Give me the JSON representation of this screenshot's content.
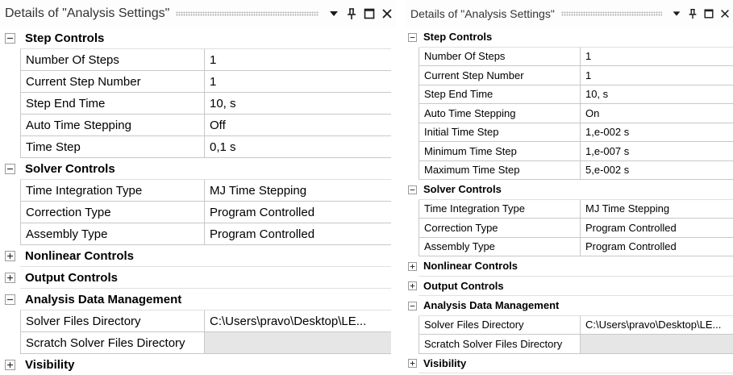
{
  "panels": [
    {
      "title": "Details of \"Analysis Settings\"",
      "sections": [
        {
          "label": "Step Controls",
          "expanded": true,
          "rows": [
            {
              "name": "Number Of Steps",
              "value": "1"
            },
            {
              "name": "Current Step Number",
              "value": "1"
            },
            {
              "name": "Step End Time",
              "value": "10, s"
            },
            {
              "name": "Auto Time Stepping",
              "value": "Off"
            },
            {
              "name": "Time Step",
              "value": "0,1 s"
            }
          ]
        },
        {
          "label": "Solver Controls",
          "expanded": true,
          "rows": [
            {
              "name": "Time Integration Type",
              "value": "MJ Time Stepping"
            },
            {
              "name": "Correction Type",
              "value": "Program Controlled"
            },
            {
              "name": "Assembly Type",
              "value": "Program Controlled"
            }
          ]
        },
        {
          "label": "Nonlinear Controls",
          "expanded": false,
          "rows": []
        },
        {
          "label": "Output Controls",
          "expanded": false,
          "rows": []
        },
        {
          "label": "Analysis Data Management",
          "expanded": true,
          "rows": [
            {
              "name": "Solver Files Directory",
              "value": "C:\\Users\\pravo\\Desktop\\LE..."
            },
            {
              "name": "Scratch Solver Files Directory",
              "value": "",
              "disabled": true
            }
          ]
        },
        {
          "label": "Visibility",
          "expanded": false,
          "rows": []
        }
      ]
    },
    {
      "title": "Details of \"Analysis Settings\"",
      "sections": [
        {
          "label": "Step Controls",
          "expanded": true,
          "rows": [
            {
              "name": "Number Of Steps",
              "value": "1"
            },
            {
              "name": "Current Step Number",
              "value": "1"
            },
            {
              "name": "Step End Time",
              "value": "10, s"
            },
            {
              "name": "Auto Time Stepping",
              "value": "On"
            },
            {
              "name": "Initial Time Step",
              "value": "1,e-002 s"
            },
            {
              "name": "Minimum Time Step",
              "value": "1,e-007 s"
            },
            {
              "name": "Maximum Time Step",
              "value": "5,e-002 s"
            }
          ]
        },
        {
          "label": "Solver Controls",
          "expanded": true,
          "rows": [
            {
              "name": "Time Integration Type",
              "value": "MJ Time Stepping"
            },
            {
              "name": "Correction Type",
              "value": "Program Controlled"
            },
            {
              "name": "Assembly Type",
              "value": "Program Controlled"
            }
          ]
        },
        {
          "label": "Nonlinear Controls",
          "expanded": false,
          "rows": []
        },
        {
          "label": "Output Controls",
          "expanded": false,
          "rows": []
        },
        {
          "label": "Analysis Data Management",
          "expanded": true,
          "rows": [
            {
              "name": "Solver Files Directory",
              "value": "C:\\Users\\pravo\\Desktop\\LE..."
            },
            {
              "name": "Scratch Solver Files Directory",
              "value": "",
              "disabled": true
            }
          ]
        },
        {
          "label": "Visibility",
          "expanded": false,
          "rows": []
        }
      ]
    }
  ],
  "titlebar_icons": [
    "dropdown-arrow-icon",
    "pin-icon",
    "maximize-icon",
    "close-icon"
  ],
  "colors": {
    "grid_line": "#c8c8c8",
    "disabled_cell": "#e6e6e6",
    "grip_dots": "#b0b0b0"
  }
}
